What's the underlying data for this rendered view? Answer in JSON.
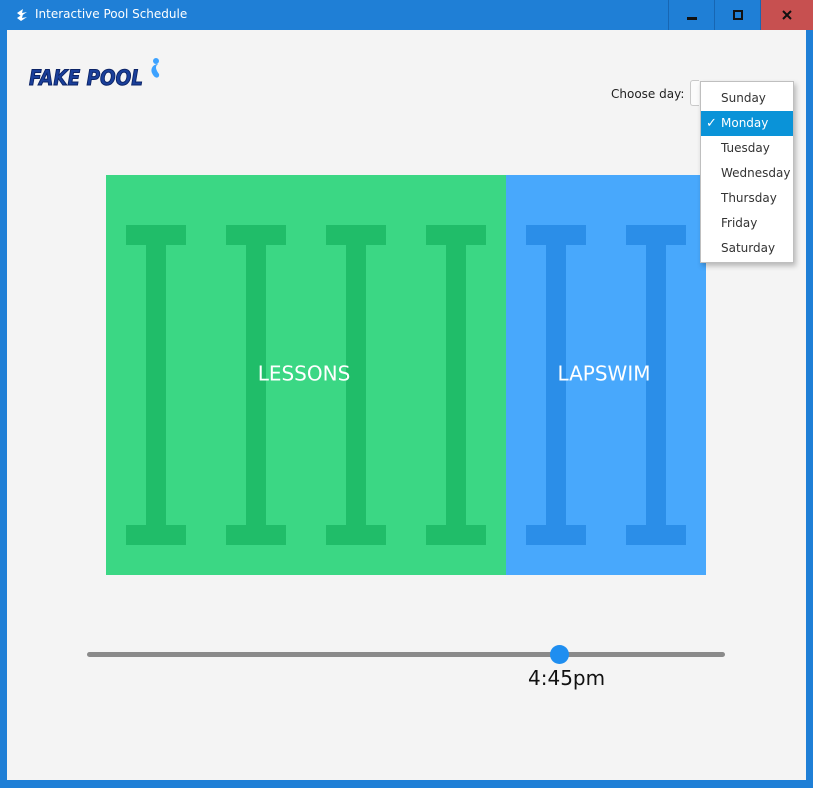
{
  "window": {
    "title": "Interactive Pool Schedule",
    "frame_color": "#1f7fd6",
    "close_color": "#c75050",
    "controls": {
      "minimize": "minimize-icon",
      "maximize": "maximize-icon",
      "close": "close-icon"
    }
  },
  "logo": {
    "text": "FAKE POOL"
  },
  "day_picker": {
    "label": "Choose day:",
    "selected": "Monday",
    "options": [
      "Sunday",
      "Monday",
      "Tuesday",
      "Wednesday",
      "Thursday",
      "Friday",
      "Saturday"
    ],
    "selected_index": 1
  },
  "pool": {
    "zones": [
      {
        "label": "LESSONS",
        "lanes": 4,
        "color": "#3bd784",
        "lane_color": "#20bd69"
      },
      {
        "label": "LAPSWIM",
        "lanes": 2,
        "color": "#48a8fc",
        "lane_color": "#2b8ee8"
      }
    ]
  },
  "time_slider": {
    "display": "4:45pm",
    "fraction": 0.74,
    "thumb_color": "#1f8ef0"
  }
}
